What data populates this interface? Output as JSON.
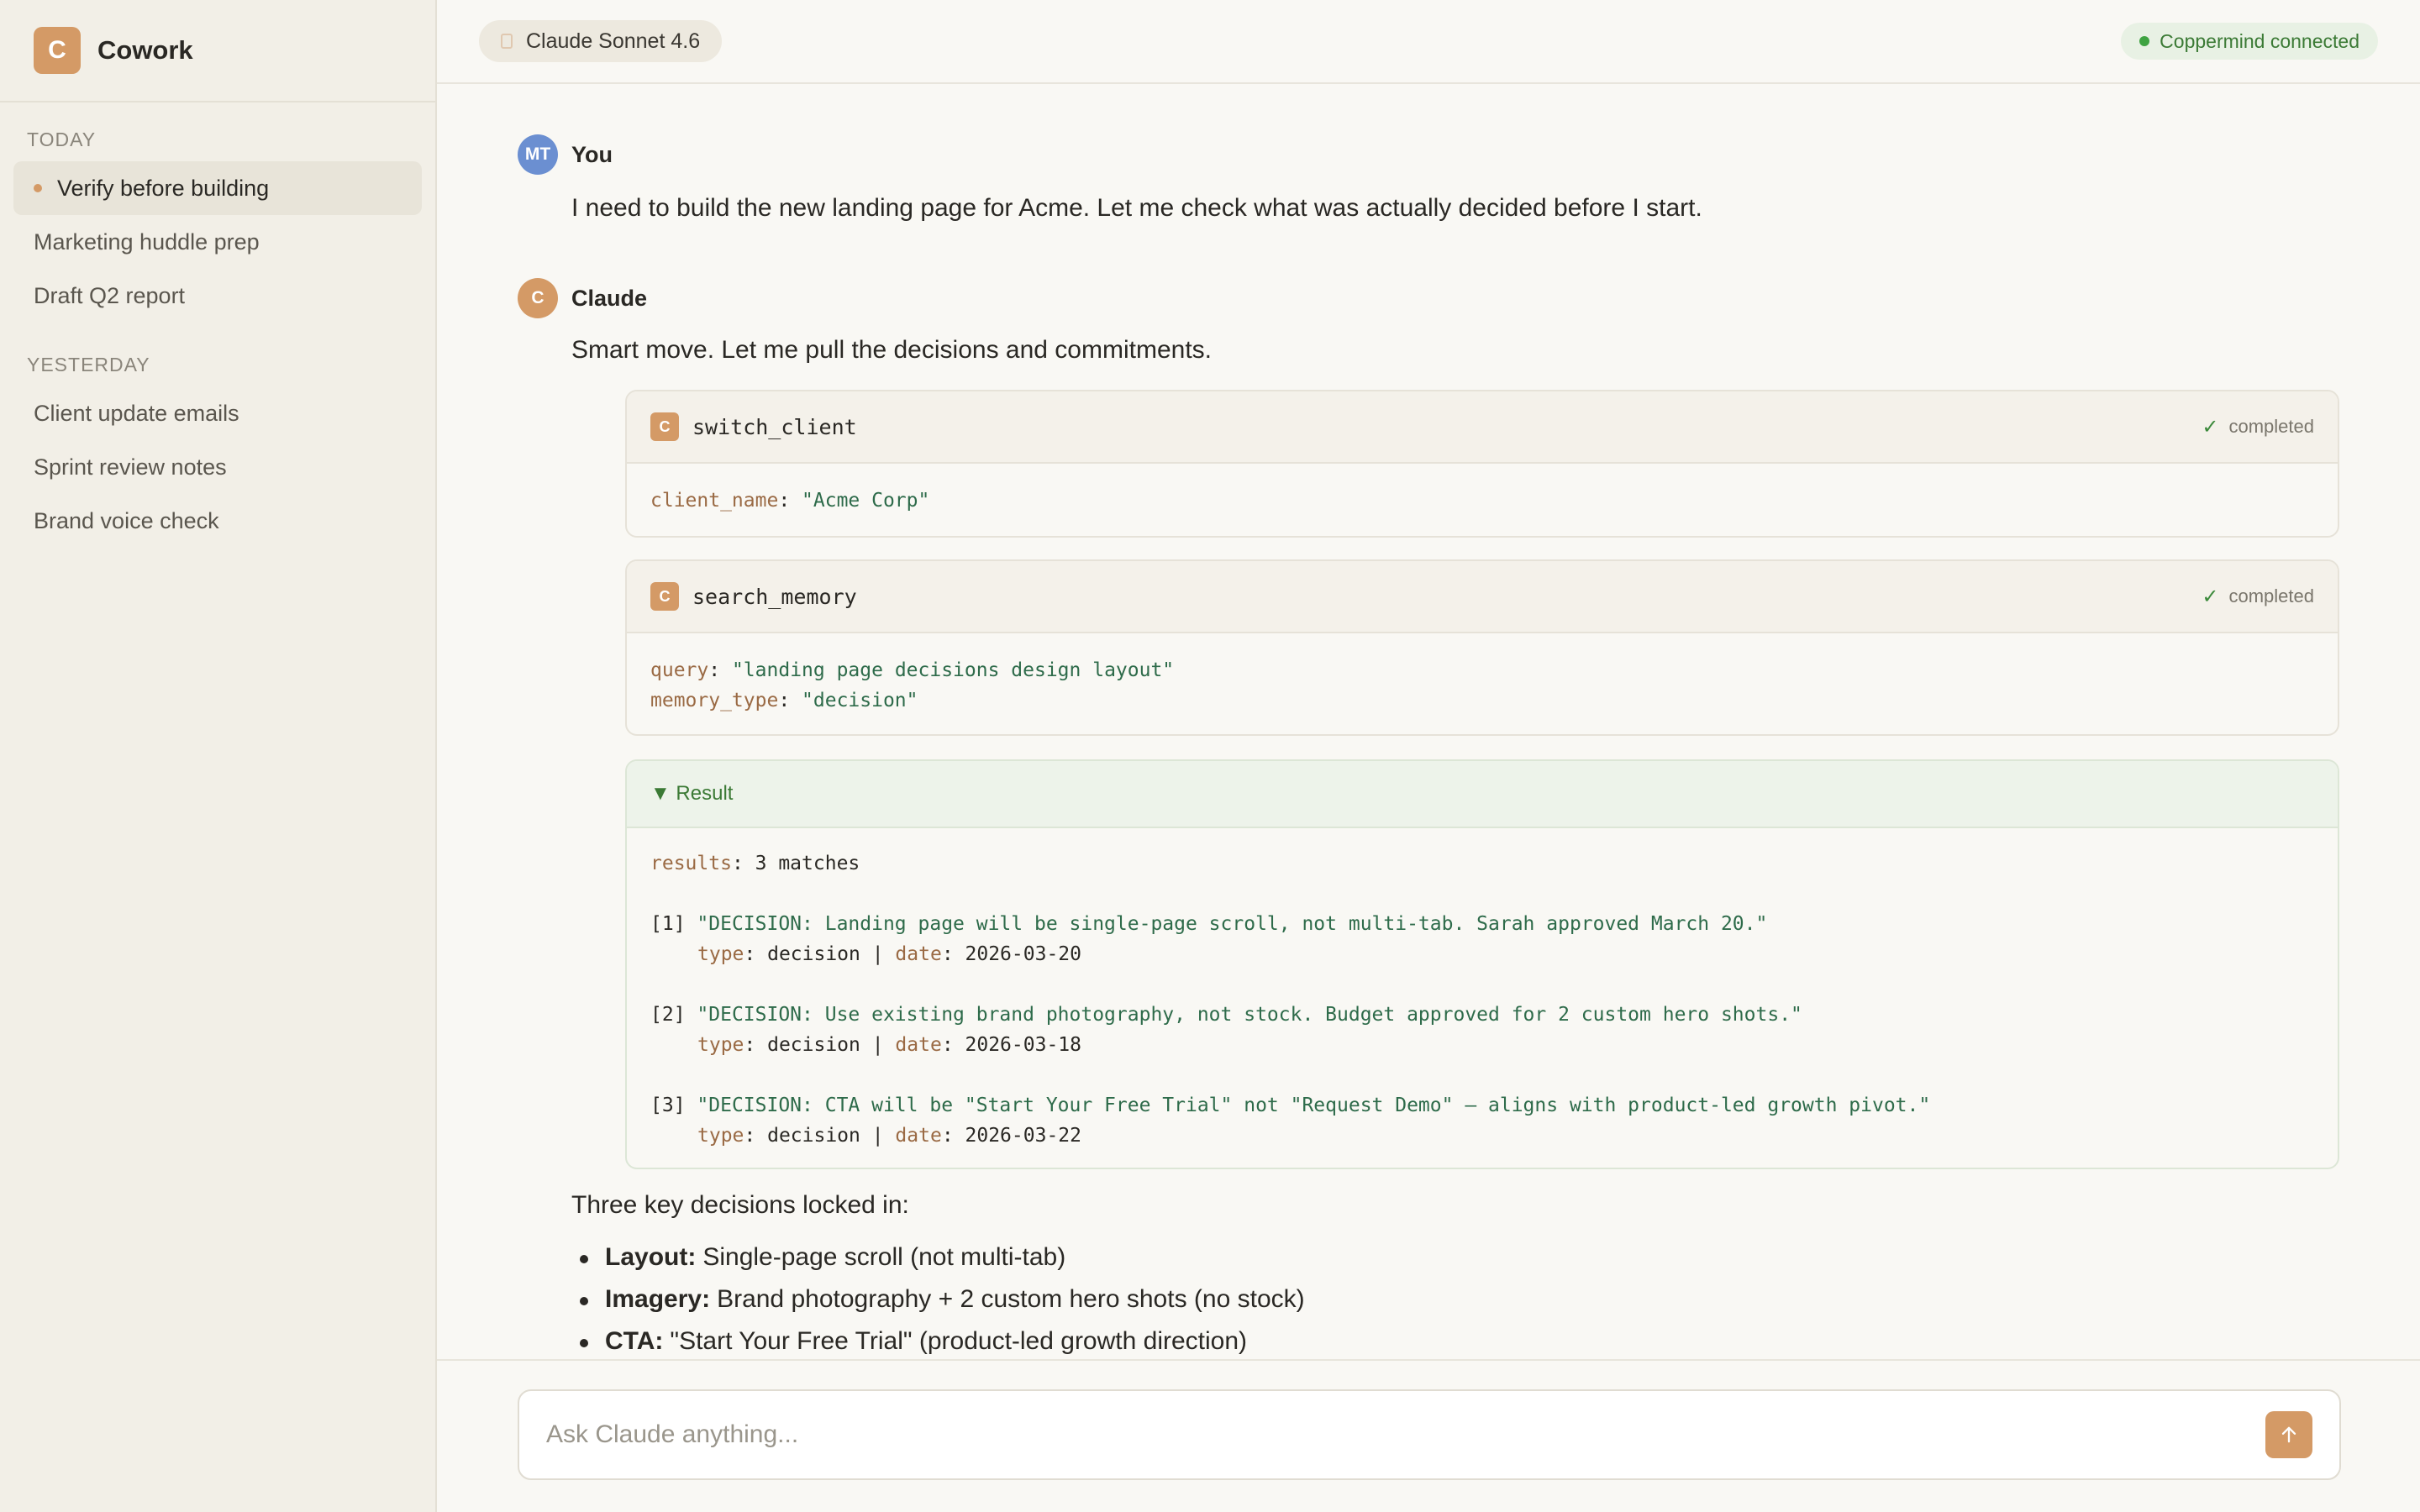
{
  "app": {
    "logo_letter": "C",
    "name": "Cowork"
  },
  "sidebar": {
    "sections": [
      {
        "title": "TODAY",
        "items": [
          {
            "label": "Verify before building",
            "active": true
          },
          {
            "label": "Marketing huddle prep"
          },
          {
            "label": "Draft Q2 report"
          }
        ]
      },
      {
        "title": "YESTERDAY",
        "items": [
          {
            "label": "Client update emails"
          },
          {
            "label": "Sprint review notes"
          },
          {
            "label": "Brand voice check"
          }
        ]
      }
    ]
  },
  "topbar": {
    "model": "Claude Sonnet 4.6",
    "connection": "Coppermind connected"
  },
  "messages": {
    "user": {
      "avatar": "MT",
      "name": "You",
      "text": "I need to build the new landing page for Acme. Let me check what was actually decided before I start."
    },
    "claude": {
      "avatar": "C",
      "name": "Claude",
      "intro": "Smart move. Let me pull the decisions and commitments."
    }
  },
  "tools": [
    {
      "icon": "C",
      "name": "switch_client",
      "status": "completed",
      "args": [
        {
          "key": "client_name",
          "value": "\"Acme Corp\""
        }
      ]
    },
    {
      "icon": "C",
      "name": "search_memory",
      "status": "completed",
      "args": [
        {
          "key": "query",
          "value": "\"landing page decisions design layout\""
        },
        {
          "key": "memory_type",
          "value": "\"decision\""
        }
      ]
    }
  ],
  "result": {
    "label": "▼ Result",
    "summary_key": "results",
    "summary_value": "3 matches",
    "items": [
      {
        "index": "[1]",
        "text": "\"DECISION: Landing page will be single-page scroll, not multi-tab. Sarah approved March 20.\"",
        "type": "decision",
        "date": "2026-03-20"
      },
      {
        "index": "[2]",
        "text": "\"DECISION: Use existing brand photography, not stock. Budget approved for 2 custom hero shots.\"",
        "type": "decision",
        "date": "2026-03-18"
      },
      {
        "index": "[3]",
        "text": "\"DECISION: CTA will be \"Start Your Free Trial\" not \"Request Demo\" — aligns with product-led growth pivot.\"",
        "type": "decision",
        "date": "2026-03-22"
      }
    ],
    "meta_type_key": "type",
    "meta_date_key": "date"
  },
  "summary": {
    "heading": "Three key decisions locked in:",
    "bullets": [
      {
        "label": "Layout:",
        "text": "Single-page scroll (not multi-tab)"
      },
      {
        "label": "Imagery:",
        "text": "Brand photography + 2 custom hero shots (no stock)"
      },
      {
        "label": "CTA:",
        "text": "\"Start Your Free Trial\" (product-led growth direction)"
      }
    ]
  },
  "composer": {
    "placeholder": "Ask Claude anything...",
    "send_icon": "arrow-up-icon"
  },
  "status_icons": {
    "completed": "check-icon"
  }
}
